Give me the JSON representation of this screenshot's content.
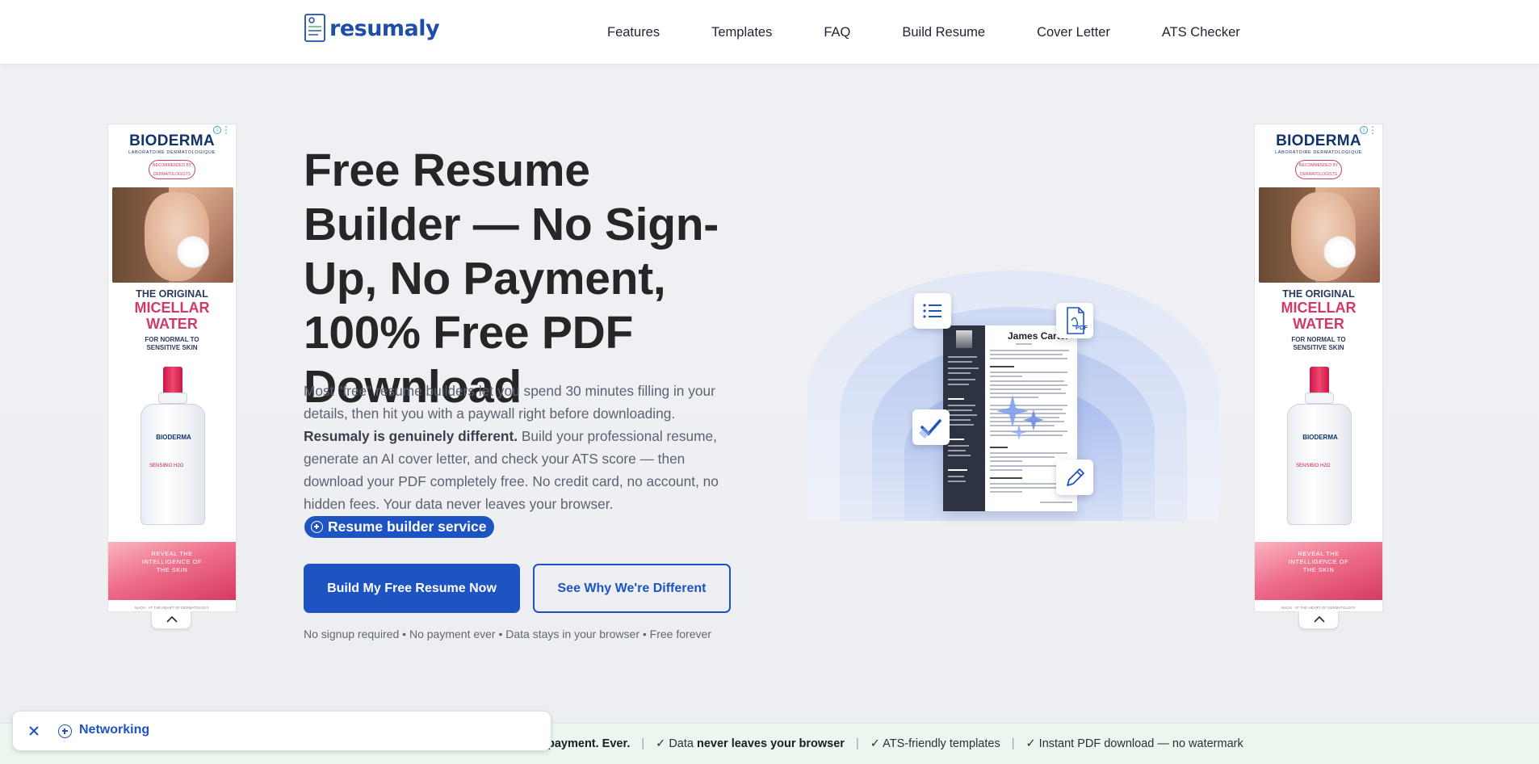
{
  "header": {
    "logo_text": "resumaly",
    "nav": [
      "Features",
      "Templates",
      "FAQ",
      "Build Resume",
      "Cover Letter",
      "ATS Checker"
    ]
  },
  "ad": {
    "brand": "BIODERMA",
    "sub": "LABORATOIRE DERMATOLOGIQUE",
    "badge": "RECOMMENDED BY DERMATOLOGISTS",
    "line1": "THE ORIGINAL",
    "line2": "MICELLAR WATER",
    "line3": "FOR NORMAL TO SENSITIVE SKIN",
    "bottle_brand": "BIODERMA",
    "bottle_product": "SENSIBIO H2O",
    "wave_text": "REVEAL THE INTELLIGENCE OF THE SKIN",
    "footer": "NAOS · AT THE HEART OF DERMATOLOGY",
    "info_glyph": "i",
    "menu_glyph": "⋮"
  },
  "hero": {
    "title": "Free Resume Builder — No Sign-Up, No Payment, 100% Free PDF Download",
    "desc_1": "Most \"free\" resume builders let you spend 30 minutes filling in your details, then hit you with a paywall right before downloading. ",
    "desc_bold": "Resumaly is genuinely different.",
    "desc_2": " Build your professional resume, generate an AI cover letter, and check your ATS score — then download your PDF completely free. No credit card, no account, no hidden fees. Your data never leaves your browser.",
    "service_chip": "Resume builder service",
    "primary_button": "Build My Free Resume Now",
    "secondary_button": "See Why We're Different",
    "note": "No signup required • No payment ever • Data stays in your browser • Free forever"
  },
  "illustration": {
    "resume_name": "James Carter",
    "pdf_label": "PDF"
  },
  "trust_bar": {
    "item1_bold": "payment. Ever.",
    "item2_pre": "✓ Data ",
    "item2_bold": "never leaves your browser",
    "item3": "✓ ATS-friendly templates",
    "item4": "✓ Instant PDF download — no watermark",
    "separator": "|"
  },
  "toast": {
    "label": "Networking"
  },
  "colors": {
    "brand_blue": "#1e54c2",
    "trust_bg": "#eaf6ee"
  }
}
